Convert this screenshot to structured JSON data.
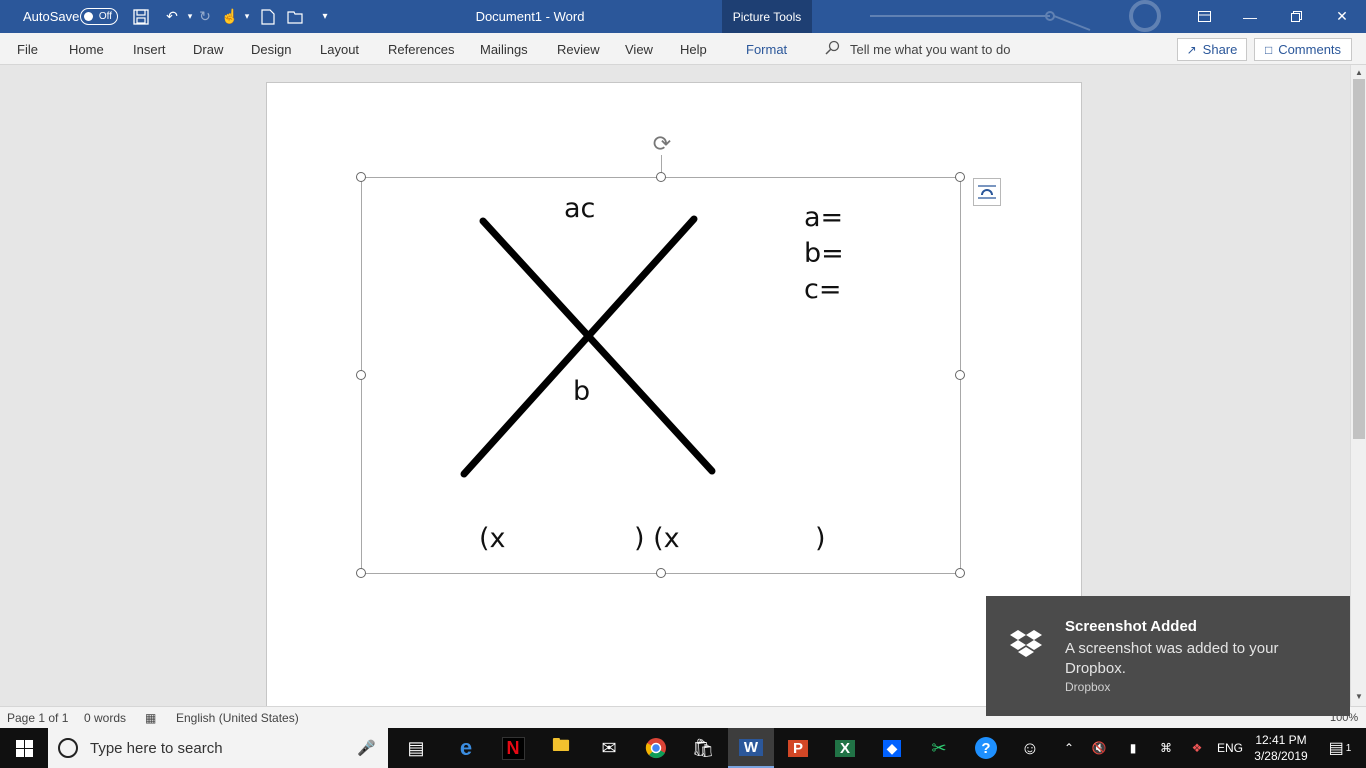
{
  "titlebar": {
    "autosave_label": "AutoSave",
    "autosave_state": "Off",
    "document_title": "Document1  -  Word",
    "context_tab": "Picture Tools",
    "qat_icons": [
      "save-icon",
      "undo-icon",
      "redo-icon",
      "touch-mode-icon",
      "new-document-icon",
      "open-icon",
      "customize-qat-icon"
    ]
  },
  "ribbon": {
    "tabs": [
      "File",
      "Home",
      "Insert",
      "Draw",
      "Design",
      "Layout",
      "References",
      "Mailings",
      "Review",
      "View",
      "Help",
      "Format"
    ],
    "tell_me": "Tell me what you want to do",
    "share": "Share",
    "comments": "Comments",
    "accent_color": "#2b579a"
  },
  "picture": {
    "label_ac": "ac",
    "label_b": "b",
    "var_a": "a=",
    "var_b": "b=",
    "var_c": "c=",
    "factor_open_1": "(x",
    "factor_mid": ") (x",
    "factor_close": ")"
  },
  "statusbar": {
    "page": "Page 1 of 1",
    "words": "0 words",
    "language": "English (United States)",
    "zoom": "100%"
  },
  "taskbar": {
    "search_placeholder": "Type here to search",
    "apps": [
      "task-view-icon",
      "edge-icon",
      "netflix-icon",
      "file-explorer-icon",
      "mail-icon",
      "chrome-icon",
      "store-icon",
      "word-icon",
      "powerpoint-icon",
      "excel-icon",
      "dropbox-icon",
      "snipping-tool-icon",
      "help-icon",
      "people-icon"
    ],
    "language": "ENG",
    "time": "12:41 PM",
    "date": "3/28/2019",
    "notification_count": "1"
  },
  "toast": {
    "title": "Screenshot Added",
    "body": "A screenshot was added to your Dropbox.",
    "source": "Dropbox"
  }
}
